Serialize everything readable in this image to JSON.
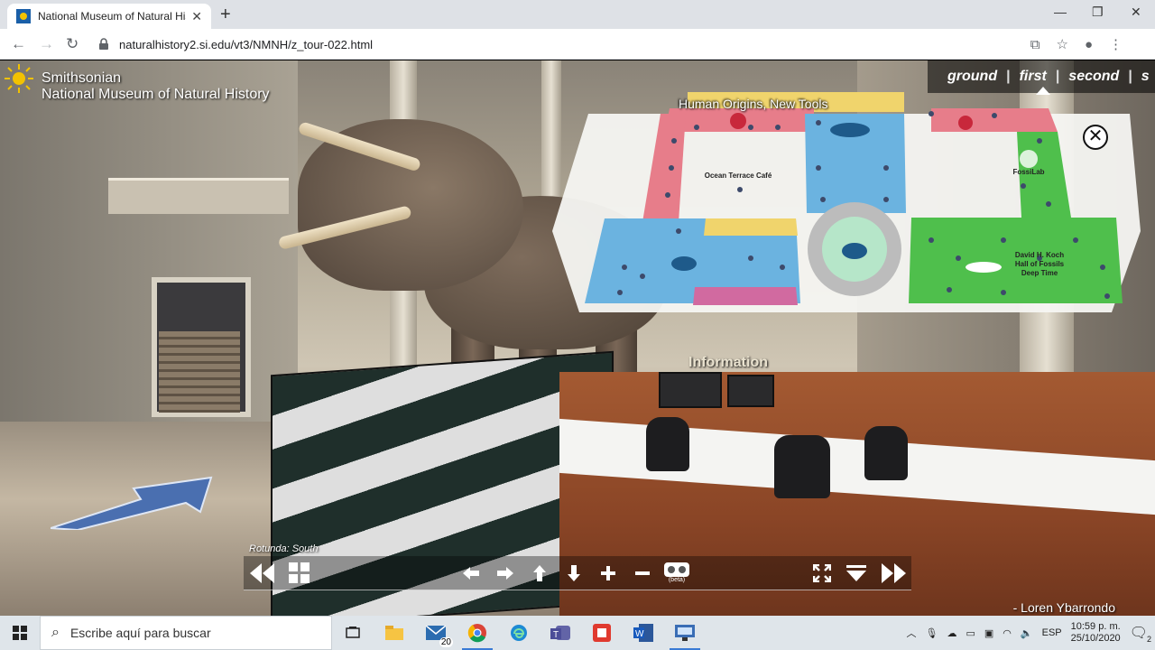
{
  "browser": {
    "tab_title": "National Museum of Natural Histo",
    "url": "naturalhistory2.si.edu/vt3/NMNH/z_tour-022.html",
    "new_tab_symbol": "+",
    "window_controls": {
      "minimize": "—",
      "maximize": "❐",
      "close": "✕"
    }
  },
  "logo": {
    "line1": "Smithsonian",
    "line2": "National Museum of Natural History"
  },
  "floors": {
    "ground": "ground",
    "first": "first",
    "second": "second",
    "partial": "s"
  },
  "map": {
    "tooltip": "Human Origins, New Tools",
    "ocean_cafe": "Ocean Terrace Café",
    "fossilab": "FossiLab",
    "fossil_hall_line1": "David H. Koch",
    "fossil_hall_line2": "Hall of Fossils",
    "fossil_hall_line3": "Deep Time",
    "close_symbol": "✕",
    "colors": {
      "pink": "#e77d8a",
      "blue": "#6bb3e0",
      "green": "#4fbf4c",
      "yellow": "#f0d46c",
      "dark_blue": "#1e5a8a"
    }
  },
  "scene": {
    "information_sign": "Information",
    "location": "Rotunda: South",
    "credit": "- Loren Ybarrondo"
  },
  "controls": {
    "vr_beta": "(beta)"
  },
  "taskbar": {
    "search_placeholder": "Escribe aquí para buscar",
    "mail_badge": "20",
    "lang": "ESP",
    "time": "10:59 p. m.",
    "date": "25/10/2020",
    "notifications": "2"
  }
}
